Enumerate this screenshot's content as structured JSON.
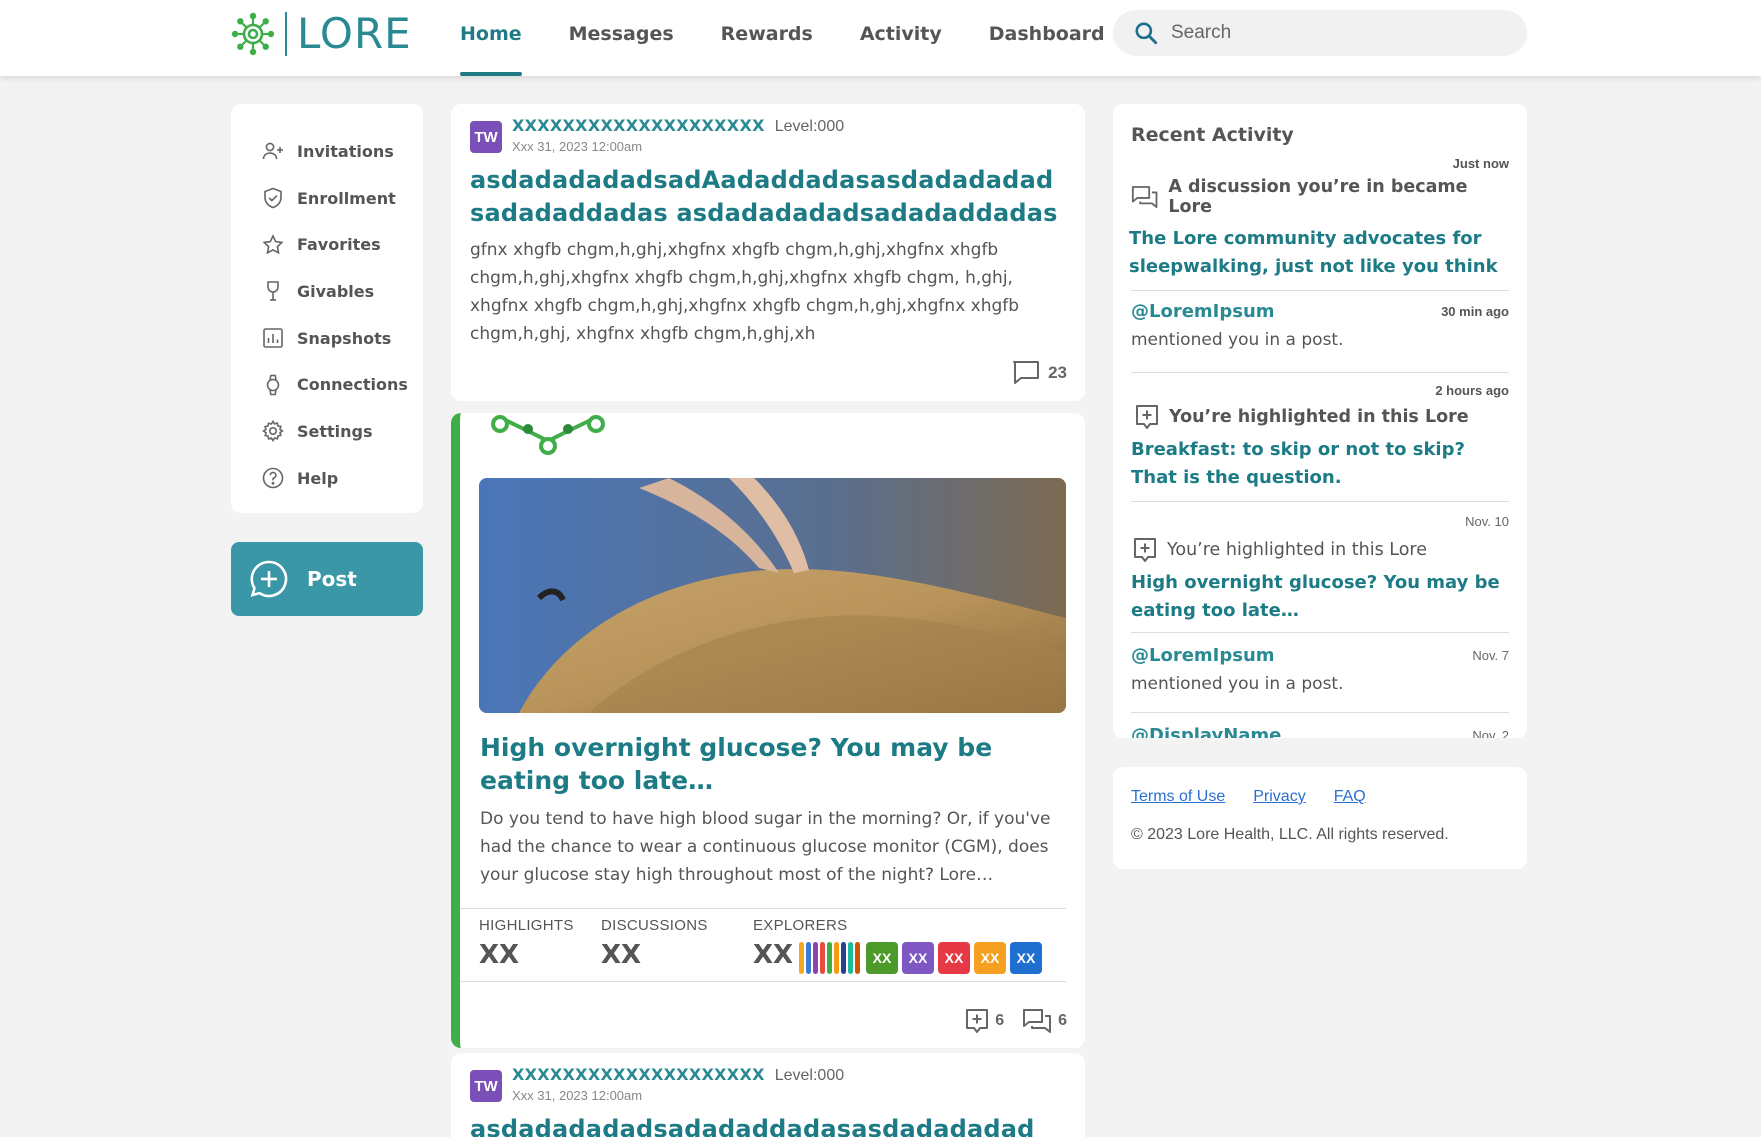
{
  "brand": {
    "name": "LORE",
    "color": "#2a8a93",
    "accent": "#3fae49"
  },
  "nav": {
    "items": [
      {
        "label": "Home",
        "active": true
      },
      {
        "label": "Messages",
        "active": false
      },
      {
        "label": "Rewards",
        "active": false
      },
      {
        "label": "Activity",
        "active": false
      },
      {
        "label": "Dashboard",
        "active": false
      }
    ]
  },
  "search": {
    "placeholder": "Search",
    "icon": "search-icon"
  },
  "sidebar": {
    "items": [
      {
        "label": "Invitations",
        "icon": "add-person-icon"
      },
      {
        "label": "Enrollment",
        "icon": "shield-check-icon"
      },
      {
        "label": "Favorites",
        "icon": "star-icon"
      },
      {
        "label": "Givables",
        "icon": "trophy-icon"
      },
      {
        "label": "Snapshots",
        "icon": "chart-icon"
      },
      {
        "label": "Connections",
        "icon": "watch-icon"
      },
      {
        "label": "Settings",
        "icon": "gear-icon"
      },
      {
        "label": "Help",
        "icon": "help-icon"
      }
    ],
    "post_button": "Post"
  },
  "feed": {
    "post1": {
      "avatar": "TW",
      "author": "XXXXXXXXXXXXXXXXXXXX",
      "level": "Level:000",
      "date": "Xxx 31, 2023 12:00am",
      "title": "asdadadadadsadAadaddadasasdadadadad sadadaddadas asdadadadadsadadaddadas",
      "body": "gfnx xhgfb chgm,h,ghj,xhgfnx xhgfb chgm,h,ghj,xhgfnx xhgfb chgm,h,ghj,xhgfnx xhgfb chgm,h,ghj,xhgfnx xhgfb chgm, h,ghj, xhgfnx xhgfb chgm,h,ghj,xhgfnx xhgfb chgm,h,ghj,xhgfnx xhgfb chgm,h,ghj, xhgfnx xhgfb chgm,h,ghj,xh",
      "comments": "23"
    },
    "lore": {
      "title": "High overnight glucose? You may be eating too late…",
      "excerpt": "Do you tend to have high blood sugar in the morning? Or, if you've had the chance to wear a continuous glucose monitor (CGM), does your glucose stay high throughout most of the night? Lore…",
      "stats": {
        "highlights_label": "HIGHLIGHTS",
        "highlights_value": "XX",
        "discussions_label": "DISCUSSIONS",
        "discussions_value": "XX",
        "explorers_label": "EXPLORERS",
        "explorers_value": "XX"
      },
      "explorer_stripes": [
        "#f5a623",
        "#3a7bd5",
        "#8e44ad",
        "#e74c3c",
        "#3fae49",
        "#f39c12",
        "#2c3e8f",
        "#1abc9c",
        "#d35400"
      ],
      "explorer_badges": [
        {
          "label": "XX",
          "color": "#4c9a2a"
        },
        {
          "label": "XX",
          "color": "#7e57c2"
        },
        {
          "label": "XX",
          "color": "#e53946"
        },
        {
          "label": "XX",
          "color": "#f5a020"
        },
        {
          "label": "XX",
          "color": "#1e6fcf"
        }
      ],
      "highlight_count": "6",
      "discussion_count": "6"
    },
    "post3": {
      "avatar": "TW",
      "author": "XXXXXXXXXXXXXXXXXXXX",
      "level": "Level:000",
      "date": "Xxx 31, 2023 12:00am",
      "title": "asdadadadadsadadaddadasasdadadadad"
    }
  },
  "recent": {
    "title": "Recent Activity",
    "items": [
      {
        "time": "Just now",
        "head": "A discussion you’re in became Lore",
        "link": "The Lore community advocates for sleepwalking, just not like you think"
      },
      {
        "time": "30 min ago",
        "user": "@LoremIpsum",
        "msg": "mentioned you in a post."
      },
      {
        "time": "2 hours ago",
        "head": "You’re highlighted in this Lore",
        "link": "Breakfast: to skip or not to skip? That is the question."
      },
      {
        "time": "Nov. 10",
        "head": "You’re highlighted in this Lore",
        "link": "High overnight glucose? You may be eating too late…"
      },
      {
        "time": "Nov. 7",
        "user": "@LoremIpsum",
        "msg": "mentioned you in a post."
      },
      {
        "time": "Nov. 2",
        "user": "@DisplayName"
      }
    ]
  },
  "footer": {
    "links": [
      "Terms of Use",
      "Privacy",
      "FAQ"
    ],
    "copyright": "© 2023 Lore Health, LLC. All rights reserved."
  }
}
